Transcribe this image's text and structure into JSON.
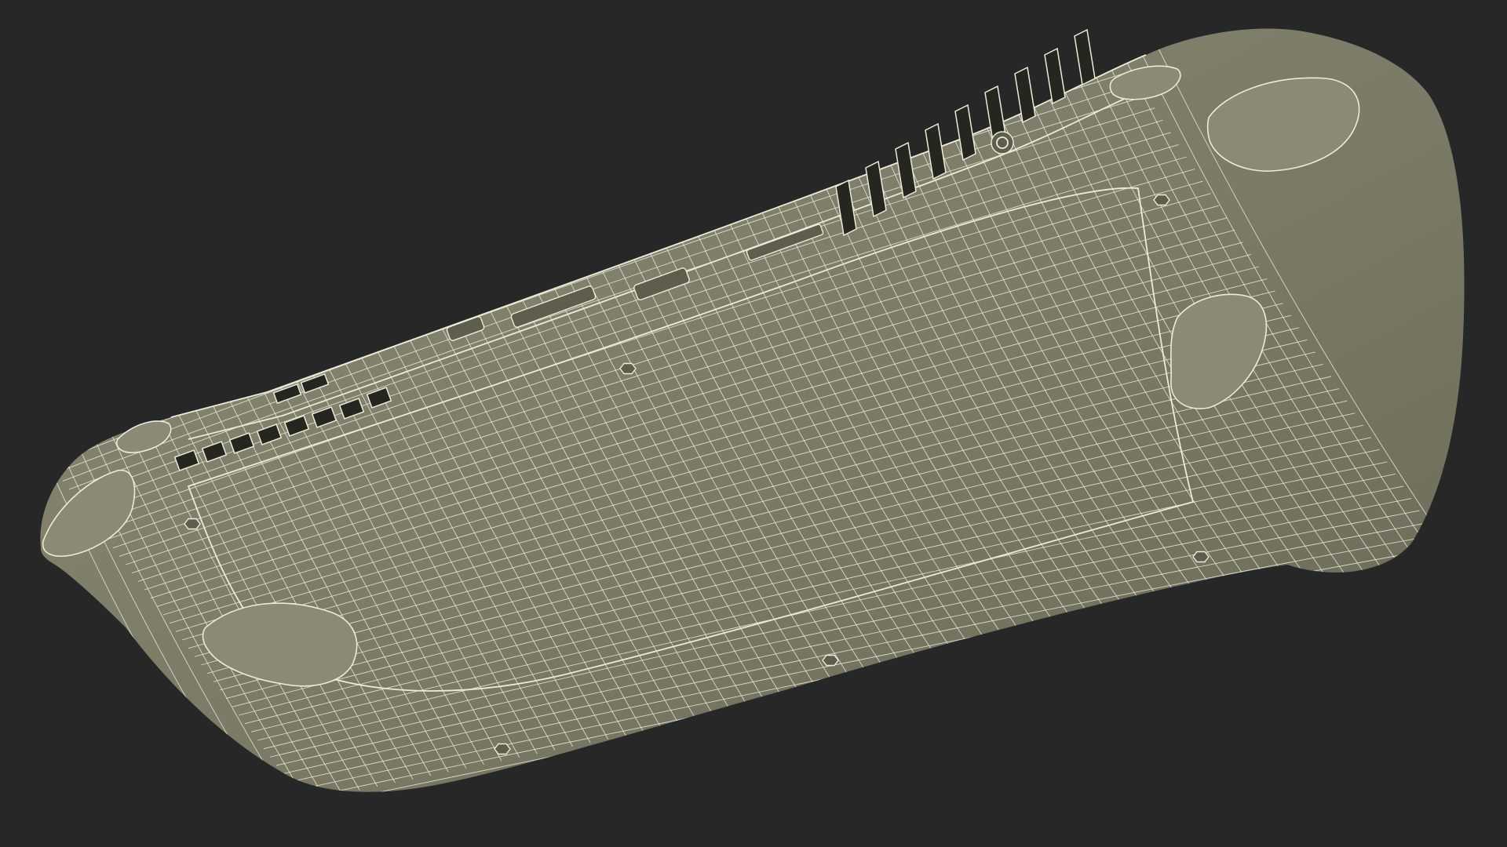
{
  "scene": {
    "subject": "handheld-console-back-wireframe",
    "colors": {
      "background": "#262727",
      "body_fill": "#7b7a66",
      "body_fill_light": "#8b8a74",
      "body_fill_dark": "#5f5e4e",
      "wire": "#ecebd8",
      "vent_slot": "#262621"
    }
  }
}
